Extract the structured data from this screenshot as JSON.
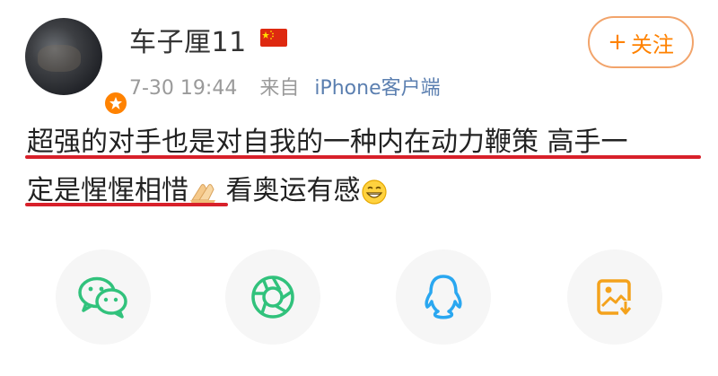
{
  "post": {
    "author": {
      "name": "车子厘11",
      "avatar_icon": "avatar-photo",
      "badge_icon": "verified-badge-icon",
      "flag_icon": "china-flag-icon"
    },
    "timestamp": "7-30 19:44",
    "source_prefix": "来自",
    "source_client": "iPhone客户端",
    "follow_button": {
      "plus": "+",
      "label": "关注"
    },
    "content": {
      "line1": "超强的对手也是对自我的一种内在动力鞭策 高手一",
      "line2_part1": "定是惺惺相惜",
      "line2_part2": "看奥运有感",
      "emoji_1": "folded-hands-emoji",
      "emoji_2": "grinning-face-emoji"
    }
  },
  "share": {
    "items": [
      {
        "icon": "wechat-icon",
        "color": "#31c27c"
      },
      {
        "icon": "moments-icon",
        "color": "#31c27c"
      },
      {
        "icon": "qq-icon",
        "color": "#2aa7f0"
      },
      {
        "icon": "save-image-icon",
        "color": "#f4a21c"
      }
    ]
  },
  "colors": {
    "accent_orange": "#ff8200",
    "link_blue": "#5b7fb0",
    "underline_red": "#d8202a"
  }
}
